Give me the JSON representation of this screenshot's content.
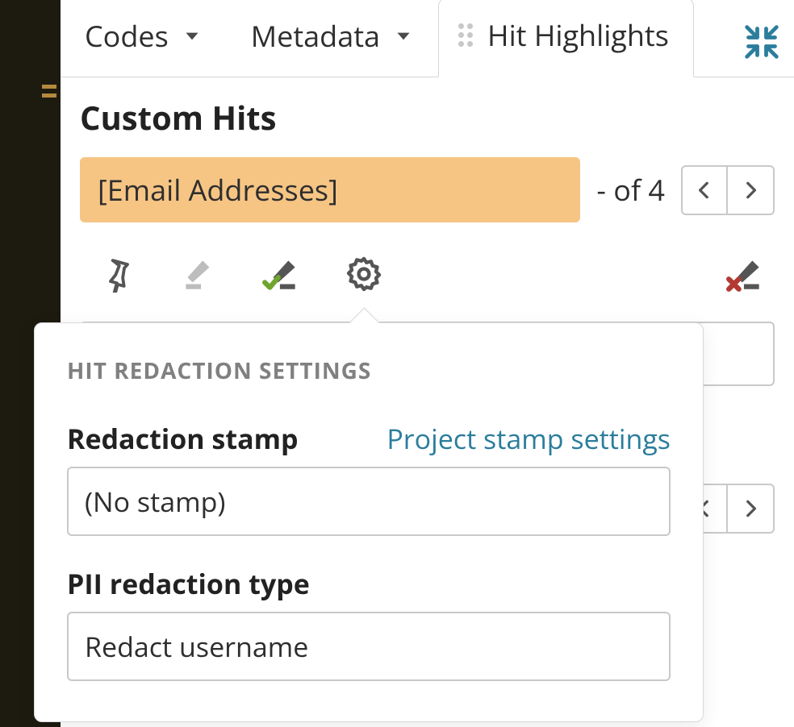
{
  "tabs": {
    "codes": "Codes",
    "metadata": "Metadata",
    "hit_highlights": "Hit Highlights"
  },
  "panel": {
    "title": "Custom Hits",
    "hit_label": "[Email Addresses]",
    "count_text": "- of 4"
  },
  "popover": {
    "header": "HIT REDACTION SETTINGS",
    "stamp_label": "Redaction stamp",
    "stamp_link": "Project stamp settings",
    "stamp_value": "(No stamp)",
    "pii_label": "PII redaction type",
    "pii_value": "Redact username"
  }
}
